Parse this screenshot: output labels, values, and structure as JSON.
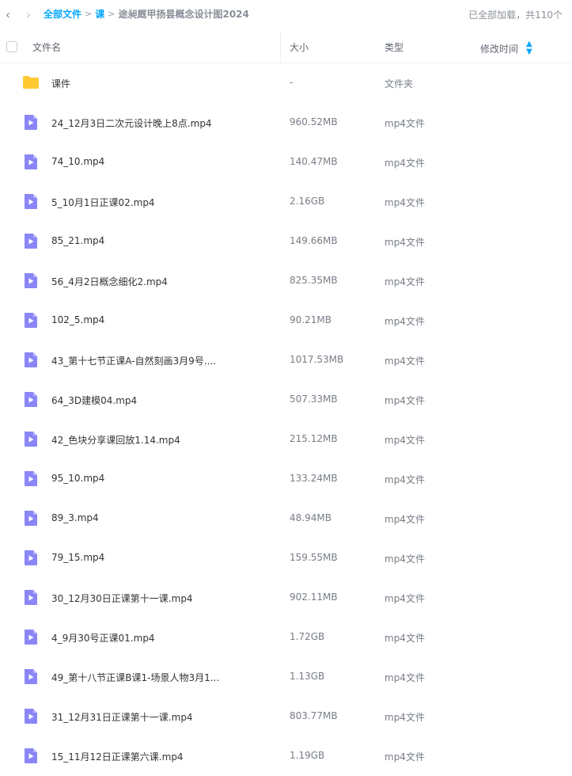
{
  "nav": {
    "back_icon": "chevron-left-icon",
    "forward_icon": "chevron-right-icon"
  },
  "breadcrumb": {
    "root": "全部文件",
    "sep": ">",
    "level1": "课",
    "current": "途昶厩甲扬昙概念设计图2024"
  },
  "status": "已全部加载，共110个",
  "columns": {
    "name": "文件名",
    "size": "大小",
    "type": "类型",
    "mtime": "修改时间"
  },
  "colors": {
    "accent": "#06a7ff",
    "folder": "#ffc933",
    "video": "#8a86f7"
  },
  "files": [
    {
      "name": "课件",
      "size": "-",
      "type": "文件夹",
      "icon": "folder-icon"
    },
    {
      "name": "24_12月3日二次元设计晚上8点.mp4",
      "size": "960.52MB",
      "type": "mp4文件",
      "icon": "video-file-icon"
    },
    {
      "name": "74_10.mp4",
      "size": "140.47MB",
      "type": "mp4文件",
      "icon": "video-file-icon"
    },
    {
      "name": "5_10月1日正课02.mp4",
      "size": "2.16GB",
      "type": "mp4文件",
      "icon": "video-file-icon"
    },
    {
      "name": "85_21.mp4",
      "size": "149.66MB",
      "type": "mp4文件",
      "icon": "video-file-icon"
    },
    {
      "name": "56_4月2日概念细化2.mp4",
      "size": "825.35MB",
      "type": "mp4文件",
      "icon": "video-file-icon"
    },
    {
      "name": "102_5.mp4",
      "size": "90.21MB",
      "type": "mp4文件",
      "icon": "video-file-icon"
    },
    {
      "name": "43_第十七节正课A-自然刻画3月9号....",
      "size": "1017.53MB",
      "type": "mp4文件",
      "icon": "video-file-icon"
    },
    {
      "name": "64_3D建模04.mp4",
      "size": "507.33MB",
      "type": "mp4文件",
      "icon": "video-file-icon"
    },
    {
      "name": "42_色块分享课回放1.14.mp4",
      "size": "215.12MB",
      "type": "mp4文件",
      "icon": "video-file-icon"
    },
    {
      "name": "95_10.mp4",
      "size": "133.24MB",
      "type": "mp4文件",
      "icon": "video-file-icon"
    },
    {
      "name": "89_3.mp4",
      "size": "48.94MB",
      "type": "mp4文件",
      "icon": "video-file-icon"
    },
    {
      "name": "79_15.mp4",
      "size": "159.55MB",
      "type": "mp4文件",
      "icon": "video-file-icon"
    },
    {
      "name": "30_12月30日正课第十一课.mp4",
      "size": "902.11MB",
      "type": "mp4文件",
      "icon": "video-file-icon"
    },
    {
      "name": "4_9月30号正课01.mp4",
      "size": "1.72GB",
      "type": "mp4文件",
      "icon": "video-file-icon"
    },
    {
      "name": "49_第十八节正课B课1-场景人物3月1...",
      "size": "1.13GB",
      "type": "mp4文件",
      "icon": "video-file-icon"
    },
    {
      "name": "31_12月31日正课第十一课.mp4",
      "size": "803.77MB",
      "type": "mp4文件",
      "icon": "video-file-icon"
    },
    {
      "name": "15_11月12日正课第六课.mp4",
      "size": "1.19GB",
      "type": "mp4文件",
      "icon": "video-file-icon"
    }
  ]
}
